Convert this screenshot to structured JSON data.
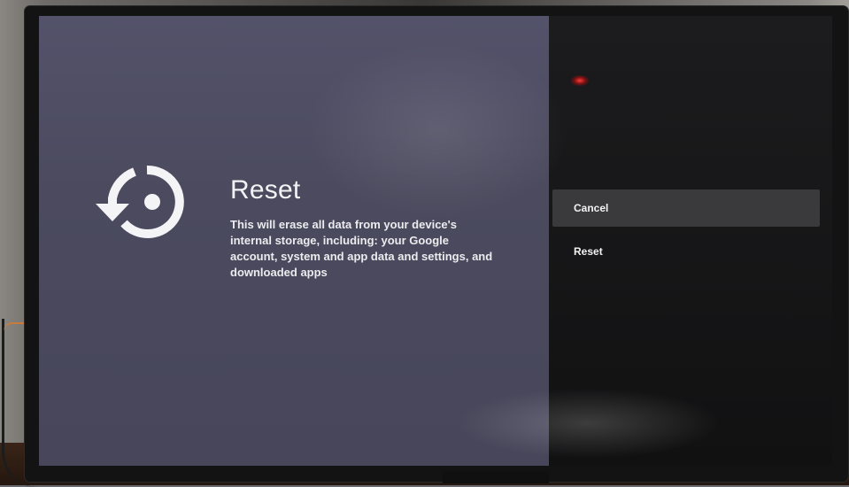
{
  "screen": {
    "title": "Reset",
    "description": "This will erase all data from your device's internal storage, including: your Google account, system and app data and settings, and downloaded apps",
    "icon": "reset-icon"
  },
  "menu": {
    "items": [
      {
        "label": "Cancel",
        "focused": true
      },
      {
        "label": "Reset",
        "focused": false
      }
    ]
  },
  "colors": {
    "left_panel": "#4b4a5e",
    "right_panel": "#151516",
    "focus_highlight": "#3a3a3d",
    "text": "#f2f2f4"
  }
}
